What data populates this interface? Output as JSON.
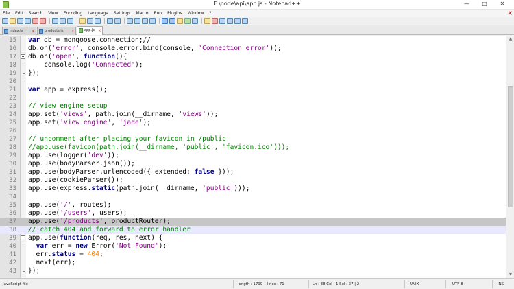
{
  "window": {
    "title": "E:\\node\\api\\app.js - Notepad++",
    "controls": {
      "minimize": "—",
      "maximize": "□",
      "close": "✕"
    }
  },
  "menu": {
    "items": [
      "File",
      "Edit",
      "Search",
      "View",
      "Encoding",
      "Language",
      "Settings",
      "Macro",
      "Run",
      "Plugins",
      "Window",
      "?"
    ],
    "close_glyph": "X"
  },
  "toolbar": {
    "icons": [
      "new-file",
      "open-file",
      "save",
      "save-all",
      "close",
      "close-all",
      "print",
      "cut",
      "copy",
      "paste",
      "undo",
      "redo",
      "find",
      "replace",
      "zoom-in",
      "zoom-out",
      "sync-vertical",
      "sync-horizontal",
      "word-wrap",
      "show-all-chars",
      "indent-guide",
      "user-defined-language",
      "doc-map",
      "function-list",
      "record-macro",
      "stop-record",
      "play-macro",
      "play-multiple",
      "save-macro"
    ]
  },
  "tabs": [
    {
      "label": "index.js",
      "icon": "file-icon",
      "close": "x"
    },
    {
      "label": "products.js",
      "icon": "file-icon",
      "close": "x"
    },
    {
      "label": "app.js",
      "icon": "file-icon",
      "close": "x",
      "active": true
    }
  ],
  "editor": {
    "lines": [
      {
        "n": "15",
        "fold": "line",
        "tokens": [
          [
            "k",
            "var"
          ],
          [
            "t",
            " db = mongoose.connection;//"
          ]
        ]
      },
      {
        "n": "16",
        "fold": "line",
        "tokens": [
          [
            "t",
            "db.on("
          ],
          [
            "s",
            "'error'"
          ],
          [
            "t",
            ", console.error.bind(console, "
          ],
          [
            "s",
            "'Connection error'"
          ],
          [
            "t",
            "));"
          ]
        ]
      },
      {
        "n": "17",
        "fold": "start",
        "tokens": [
          [
            "t",
            "db.on("
          ],
          [
            "s",
            "'open'"
          ],
          [
            "t",
            ", "
          ],
          [
            "k",
            "function"
          ],
          [
            "t",
            "(){"
          ]
        ]
      },
      {
        "n": "18",
        "fold": "line",
        "tokens": [
          [
            "t",
            "    console.log("
          ],
          [
            "s",
            "'Connected'"
          ],
          [
            "t",
            ");"
          ]
        ]
      },
      {
        "n": "19",
        "fold": "end",
        "tokens": [
          [
            "t",
            "});"
          ]
        ]
      },
      {
        "n": "20",
        "fold": "",
        "tokens": []
      },
      {
        "n": "21",
        "fold": "",
        "tokens": [
          [
            "k",
            "var"
          ],
          [
            "t",
            " app = express();"
          ]
        ]
      },
      {
        "n": "22",
        "fold": "",
        "tokens": []
      },
      {
        "n": "23",
        "fold": "",
        "tokens": [
          [
            "c",
            "// view engine setup"
          ]
        ]
      },
      {
        "n": "24",
        "fold": "",
        "tokens": [
          [
            "t",
            "app.set("
          ],
          [
            "s",
            "'views'"
          ],
          [
            "t",
            ", path.join(__dirname, "
          ],
          [
            "s",
            "'views'"
          ],
          [
            "t",
            "));"
          ]
        ]
      },
      {
        "n": "25",
        "fold": "",
        "tokens": [
          [
            "t",
            "app.set("
          ],
          [
            "s",
            "'view engine'"
          ],
          [
            "t",
            ", "
          ],
          [
            "s",
            "'jade'"
          ],
          [
            "t",
            ");"
          ]
        ]
      },
      {
        "n": "26",
        "fold": "",
        "tokens": []
      },
      {
        "n": "27",
        "fold": "",
        "tokens": [
          [
            "c",
            "// uncomment after placing your favicon in /public"
          ]
        ]
      },
      {
        "n": "28",
        "fold": "",
        "tokens": [
          [
            "c",
            "//app.use(favicon(path.join(__dirname, 'public', 'favicon.ico')));"
          ]
        ]
      },
      {
        "n": "29",
        "fold": "",
        "tokens": [
          [
            "t",
            "app.use(logger("
          ],
          [
            "s",
            "'dev'"
          ],
          [
            "t",
            "));"
          ]
        ]
      },
      {
        "n": "30",
        "fold": "",
        "tokens": [
          [
            "t",
            "app.use(bodyParser.json());"
          ]
        ]
      },
      {
        "n": "31",
        "fold": "",
        "tokens": [
          [
            "t",
            "app.use(bodyParser.urlencoded({ extended: "
          ],
          [
            "k",
            "false"
          ],
          [
            "t",
            " }));"
          ]
        ]
      },
      {
        "n": "32",
        "fold": "",
        "tokens": [
          [
            "t",
            "app.use(cookieParser());"
          ]
        ]
      },
      {
        "n": "33",
        "fold": "",
        "tokens": [
          [
            "t",
            "app.use(express."
          ],
          [
            "k",
            "static"
          ],
          [
            "t",
            "(path.join(__dirname, "
          ],
          [
            "s",
            "'public'"
          ],
          [
            "t",
            ")));"
          ]
        ]
      },
      {
        "n": "34",
        "fold": "",
        "tokens": []
      },
      {
        "n": "35",
        "fold": "",
        "tokens": [
          [
            "t",
            "app.use("
          ],
          [
            "s",
            "'/'"
          ],
          [
            "t",
            ", routes);"
          ]
        ]
      },
      {
        "n": "36",
        "fold": "",
        "tokens": [
          [
            "t",
            "app.use("
          ],
          [
            "s",
            "'/users'"
          ],
          [
            "t",
            ", users);"
          ]
        ]
      },
      {
        "n": "37",
        "fold": "",
        "highlight": "sel",
        "tokens": [
          [
            "t",
            "app.use("
          ],
          [
            "s",
            "'/products'"
          ],
          [
            "t",
            ", productRouter);"
          ]
        ]
      },
      {
        "n": "38",
        "fold": "",
        "highlight": "cur",
        "tokens": [
          [
            "c",
            "// catch 404 and forward to error handler"
          ]
        ]
      },
      {
        "n": "39",
        "fold": "start",
        "tokens": [
          [
            "t",
            "app.use("
          ],
          [
            "k",
            "function"
          ],
          [
            "t",
            "(req, res, next) {"
          ]
        ]
      },
      {
        "n": "40",
        "fold": "line",
        "tokens": [
          [
            "t",
            "  "
          ],
          [
            "k",
            "var"
          ],
          [
            "t",
            " err = "
          ],
          [
            "k",
            "new"
          ],
          [
            "t",
            " Error("
          ],
          [
            "s",
            "'Not Found'"
          ],
          [
            "t",
            ");"
          ]
        ]
      },
      {
        "n": "41",
        "fold": "line",
        "tokens": [
          [
            "t",
            "  err."
          ],
          [
            "k",
            "status"
          ],
          [
            "t",
            " = "
          ],
          [
            "n",
            "404"
          ],
          [
            "t",
            ";"
          ]
        ]
      },
      {
        "n": "42",
        "fold": "line",
        "tokens": [
          [
            "t",
            "  next(err);"
          ]
        ]
      },
      {
        "n": "43",
        "fold": "end",
        "tokens": [
          [
            "t",
            "});"
          ]
        ]
      }
    ]
  },
  "status": {
    "file_type": "JavaScript file",
    "length": "length : 1799",
    "lines": "lines : 71",
    "cursor": "Ln : 38    Col : 1    Sel : 37 | 2",
    "eol": "UNIX",
    "encoding": "UTF-8",
    "mode": "INS"
  },
  "colors": {
    "keyword": "#00007f",
    "string": "#7f007f",
    "comment": "#008000",
    "number": "#ff8000",
    "selection": "#c6c6c6"
  }
}
